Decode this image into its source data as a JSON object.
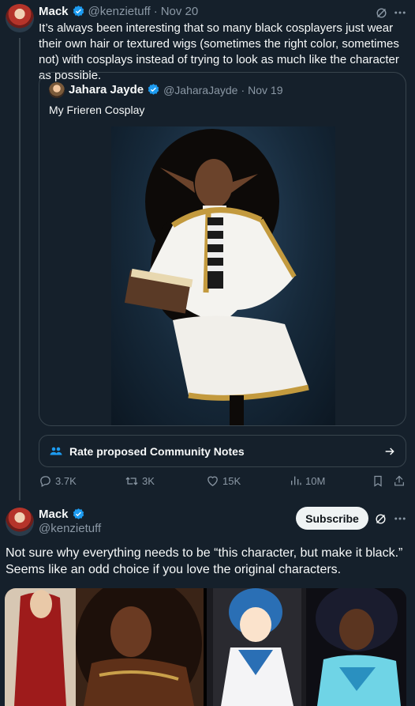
{
  "main_tweet": {
    "author_name": "Mack",
    "handle": "@kenzietuff",
    "separator": "·",
    "date": "Nov 20",
    "text": "It’s always been interesting that so many black cosplayers just wear their own hair or textured wigs (sometimes the right color, sometimes not) with cosplays instead of trying to look as much like the character as possible."
  },
  "quoted_tweet": {
    "author_name": "Jahara Jayde",
    "handle": "@JaharaJayde",
    "separator": "·",
    "date": "Nov 19",
    "text": "My Frieren Cosplay"
  },
  "community_notes": {
    "label": "Rate proposed Community Notes"
  },
  "actions": {
    "replies": "3.7K",
    "retweets": "3K",
    "likes": "15K",
    "views": "10M"
  },
  "reply_tweet": {
    "author_name": "Mack",
    "handle": "@kenzietuff",
    "subscribe_label": "Subscribe",
    "text": "Not sure why everything needs to be “this character, but make it black.” Seems like an odd choice if you love the original characters."
  },
  "colors": {
    "background": "#15202b",
    "verified_blue": "#1d9bf0",
    "muted": "#8b98a5",
    "border": "#38444d"
  }
}
